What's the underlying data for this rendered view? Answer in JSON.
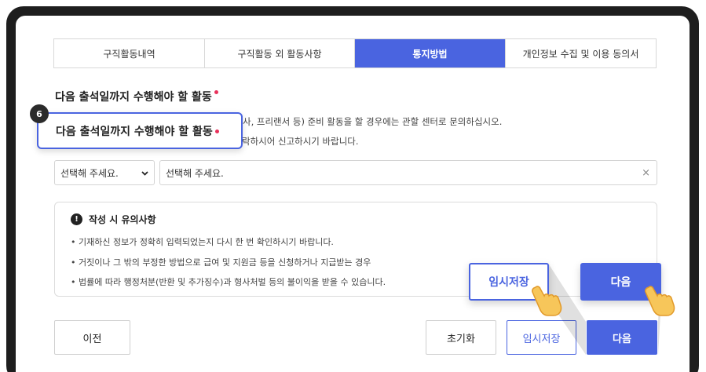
{
  "tabs": [
    {
      "label": "구직활동내역",
      "active": false
    },
    {
      "label": "구직활동 외 활동사항",
      "active": false
    },
    {
      "label": "통지방법",
      "active": true
    },
    {
      "label": "개인정보 수집 및 이용 동의서",
      "active": false
    }
  ],
  "section": {
    "title": "다음 출석일까지 수행해야 할 활동",
    "desc1": "사, 프리랜서 등) 준비 활동을 할 경우에는 관할 센터로 문의하십시오.",
    "desc2": "락하시어 신고하시기 바랍니다."
  },
  "callout": {
    "step": "6",
    "text": "다음 출석일까지 수행해야 할 활동"
  },
  "form": {
    "select_value": "선택해 주세요.",
    "input_value": "선택해 주세요.",
    "clear_icon": "×"
  },
  "notice": {
    "title": "작성 시 유의사항",
    "icon": "!",
    "items": [
      "• 기재하신 정보가 정확히 입력되었는지 다시 한 번 확인하시기 바랍니다.",
      "• 거짓이나 그 밖의 부정한 방법으로 급여 및 지원금 등을 신청하거나 지급받는 경우",
      "• 법률에 따라 행정처분(반환 및 추가징수)과 형사처벌 등의 불이익을 받을 수 있습니다."
    ]
  },
  "buttons": {
    "prev": "이전",
    "reset": "초기화",
    "temp_save": "임시저장",
    "next": "다음"
  },
  "highlight": {
    "temp_save": "임시저장",
    "next": "다음"
  },
  "colors": {
    "accent": "#4a64e0",
    "required": "#e8315b"
  }
}
